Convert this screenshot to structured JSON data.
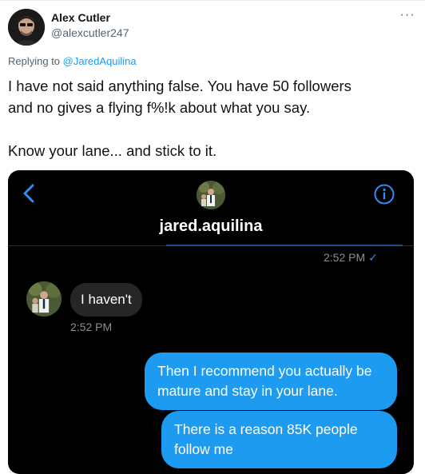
{
  "tweet": {
    "author_name": "Alex Cutler",
    "author_handle": "@alexcutler247",
    "more_label": "···",
    "replying_prefix": "Replying to ",
    "replying_to": "@JaredAquilina",
    "text_line1": "I have not said anything false. You have 50 followers",
    "text_line2": "and no gives a flying f%!k about what you say.",
    "text_line3": "Know your lane... and stick to it."
  },
  "dm": {
    "contact_name": "jared.aquilina",
    "sent_time": "2:52 PM",
    "sent_check": "✓",
    "incoming_message": "I haven't",
    "incoming_time": "2:52 PM",
    "outgoing_messages": [
      "Then I recommend you actually be mature and stay in your lane.",
      "There is a reason 85K people follow me"
    ]
  },
  "colors": {
    "accent": "#1d9bf0",
    "bubble_dark": "#262628",
    "background_dark": "#000000"
  },
  "icons": {
    "back": "chevron-left-icon",
    "info": "info-icon",
    "more": "more-icon"
  }
}
